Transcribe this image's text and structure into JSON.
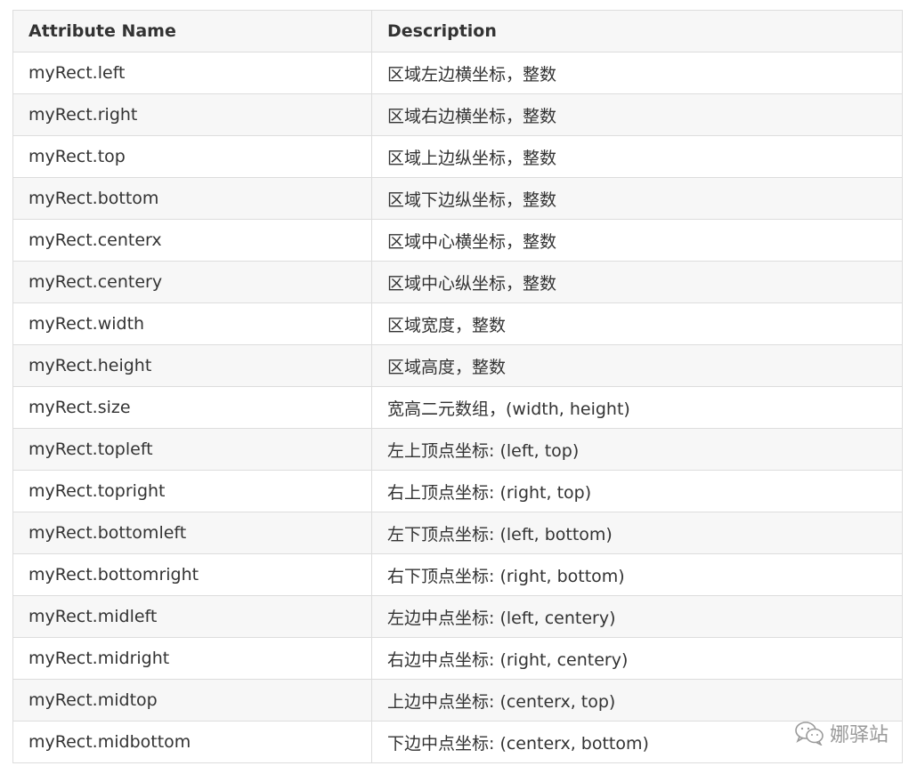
{
  "table": {
    "headers": [
      "Attribute Name",
      "Description"
    ],
    "rows": [
      [
        "myRect.left",
        "区域左边横坐标，整数"
      ],
      [
        "myRect.right",
        "区域右边横坐标，整数"
      ],
      [
        "myRect.top",
        "区域上边纵坐标，整数"
      ],
      [
        "myRect.bottom",
        "区域下边纵坐标，整数"
      ],
      [
        "myRect.centerx",
        "区域中心横坐标，整数"
      ],
      [
        "myRect.centery",
        "区域中心纵坐标，整数"
      ],
      [
        "myRect.width",
        "区域宽度，整数"
      ],
      [
        "myRect.height",
        "区域高度，整数"
      ],
      [
        "myRect.size",
        "宽高二元数组，(width, height)"
      ],
      [
        "myRect.topleft",
        "左上顶点坐标: (left, top)"
      ],
      [
        "myRect.topright",
        "右上顶点坐标: (right, top)"
      ],
      [
        "myRect.bottomleft",
        "左下顶点坐标: (left, bottom)"
      ],
      [
        "myRect.bottomright",
        "右下顶点坐标: (right, bottom)"
      ],
      [
        "myRect.midleft",
        "左边中点坐标: (left, centery)"
      ],
      [
        "myRect.midright",
        "右边中点坐标: (right, centery)"
      ],
      [
        "myRect.midtop",
        "上边中点坐标: (centerx, top)"
      ],
      [
        "myRect.midbottom",
        "下边中点坐标: (centerx, bottom)"
      ]
    ]
  },
  "watermark": {
    "icon": "wechat-icon",
    "text": "娜驿站"
  }
}
